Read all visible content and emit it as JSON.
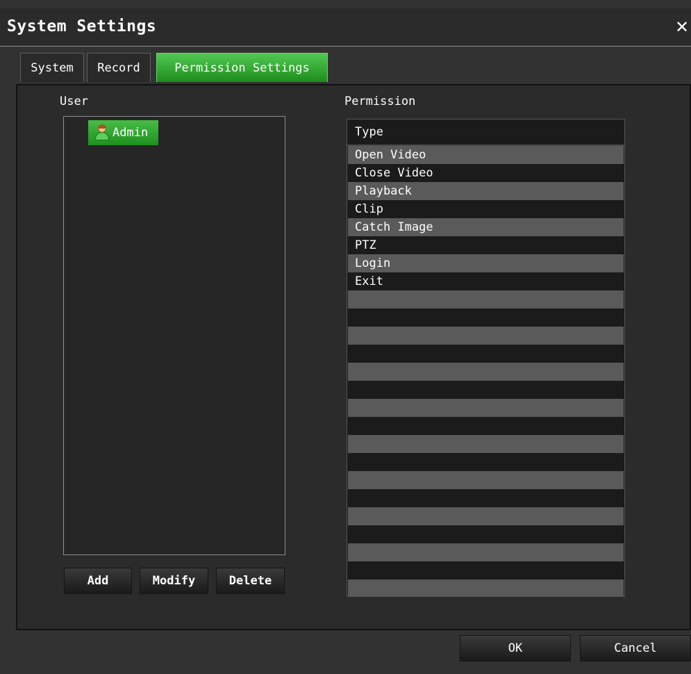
{
  "window": {
    "title": "System Settings",
    "close_label": "✕"
  },
  "tabs": [
    {
      "label": "System",
      "active": false
    },
    {
      "label": "Record",
      "active": false
    },
    {
      "label": "Permission Settings",
      "active": true
    }
  ],
  "user_panel": {
    "label": "User",
    "users": [
      {
        "name": "Admin",
        "selected": true,
        "icon": "user-icon"
      }
    ],
    "buttons": {
      "add": "Add",
      "modify": "Modify",
      "delete": "Delete"
    }
  },
  "permission_panel": {
    "label": "Permission",
    "column_header": "Type",
    "rows": [
      "Open Video",
      "Close Video",
      "Playback",
      "Clip",
      "Catch Image",
      "PTZ",
      "Login",
      "Exit"
    ],
    "empty_rows": 17
  },
  "footer": {
    "ok": "OK",
    "cancel": "Cancel"
  },
  "colors": {
    "accent_green": "#2ea82e",
    "stripe": "#5a5a5a",
    "background": "#2b2b2b"
  }
}
